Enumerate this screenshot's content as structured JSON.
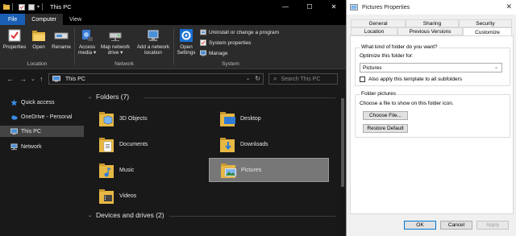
{
  "explorer": {
    "title": "This PC",
    "window_controls": [
      "—",
      "☐",
      "✕"
    ],
    "tabs": [
      "File",
      "Computer",
      "View"
    ],
    "ribbon": {
      "location": {
        "label": "Location",
        "buttons": [
          {
            "label": "Properties"
          },
          {
            "label": "Open"
          },
          {
            "label": "Rename"
          }
        ]
      },
      "network": {
        "label": "Network",
        "buttons": [
          {
            "label1": "Access",
            "label2": "media ▾"
          },
          {
            "label1": "Map network",
            "label2": "drive ▾"
          },
          {
            "label1": "Add a network",
            "label2": "location"
          }
        ]
      },
      "system": {
        "label": "System",
        "open_settings": {
          "label1": "Open",
          "label2": "Settings"
        },
        "small": [
          "Uninstall or change a program",
          "System properties",
          "Manage"
        ]
      }
    },
    "address": {
      "path": "This PC",
      "search_placeholder": "Search This PC",
      "back": "←",
      "forward": "→",
      "recent": "⌄",
      "up": "↑",
      "dropdown": "⌄",
      "refresh": "↻",
      "search_glyph": "⌕"
    },
    "nav_pane": [
      {
        "label": "Quick access",
        "icon": "star-icon"
      },
      {
        "label": "OneDrive - Personal",
        "icon": "cloud-icon"
      },
      {
        "label": "This PC",
        "icon": "computer-icon",
        "selected": true
      },
      {
        "label": "Network",
        "icon": "network-icon"
      }
    ],
    "folders_header": "Folders (7)",
    "folders": [
      {
        "name": "3D Objects",
        "icon": "cube-folder-icon"
      },
      {
        "name": "Desktop",
        "icon": "desktop-folder-icon"
      },
      {
        "name": "Documents",
        "icon": "documents-folder-icon"
      },
      {
        "name": "Downloads",
        "icon": "downloads-folder-icon"
      },
      {
        "name": "Music",
        "icon": "music-folder-icon"
      },
      {
        "name": "Pictures",
        "icon": "pictures-folder-icon",
        "selected": true
      },
      {
        "name": "Videos",
        "icon": "videos-folder-icon"
      }
    ],
    "drives_header": "Devices and drives (2)",
    "header_chevron": "⌄"
  },
  "properties": {
    "title": "Pictures Properties",
    "close": "✕",
    "tabs_row1": [
      "General",
      "Sharing",
      "Security"
    ],
    "tabs_row2": [
      "Location",
      "Previous Versions",
      "Customize"
    ],
    "active_tab": "Customize",
    "folder_type_legend": "What kind of folder do you want?",
    "optimize_label": "Optimize this folder for:",
    "optimize_value": "Pictures",
    "select_arrow": "⌄",
    "subfolders_checkbox": "Also apply this template to all subfolders",
    "subfolders_checked": false,
    "folder_pictures_legend": "Folder pictures",
    "choose_file_text": "Choose a file to show on this folder icon.",
    "choose_button": "Choose File...",
    "restore_button": "Restore Default",
    "ok": "OK",
    "cancel": "Cancel",
    "apply": "Apply"
  },
  "colors": {
    "accent": "#1a5fb4",
    "folder_yellow": "#e8b844",
    "explorer_bg": "#191919",
    "dialog_bg": "#f0f0f0"
  }
}
